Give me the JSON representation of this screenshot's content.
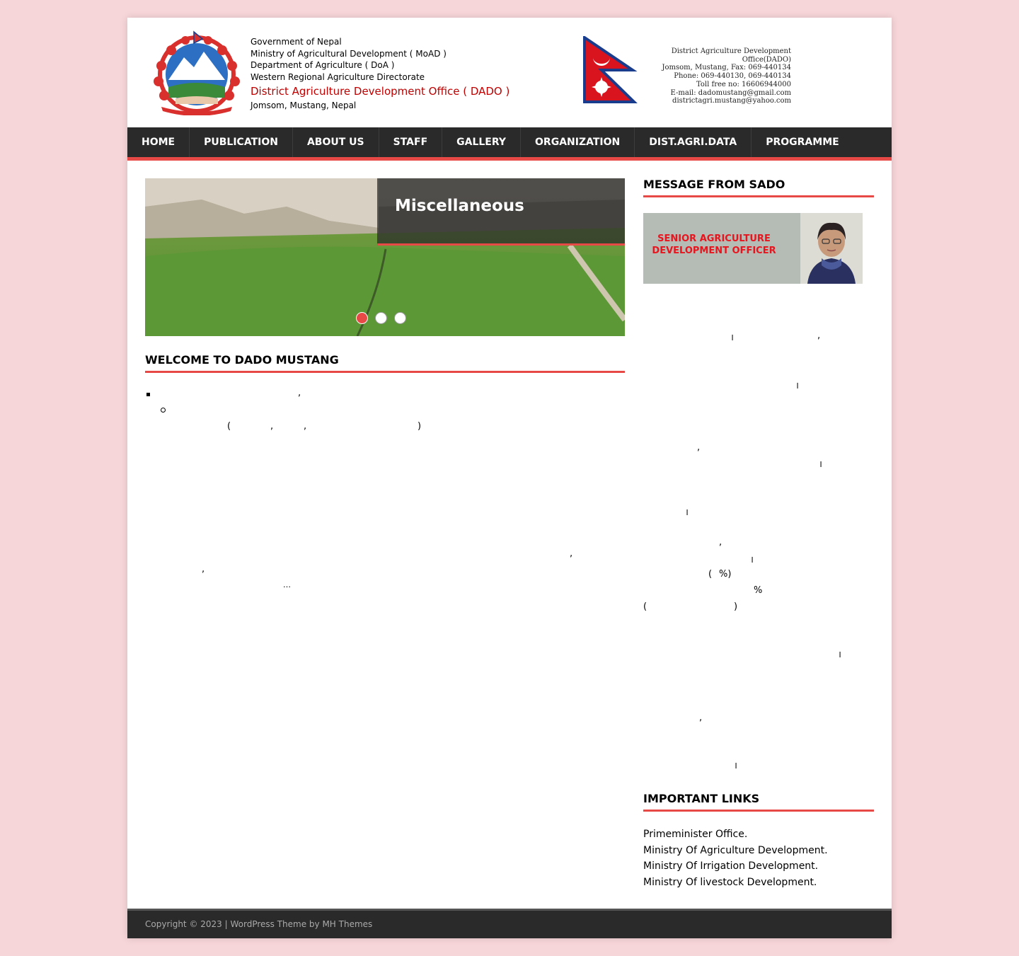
{
  "header": {
    "gov_lines": [
      "Government of Nepal",
      "Ministry of Agricultural Development ( MoAD )",
      "Department of Agriculture ( DoA )",
      "Western Regional Agriculture Directorate"
    ],
    "office_name": "District Agriculture Development Office ( DADO )",
    "location": "Jomsom, Mustang, Nepal",
    "contact_lines": [
      "District Agriculture Development Office(DADO)",
      "Jomsom, Mustang, Fax: 069-440134",
      "Phone: 069-440130, 069-440134",
      "Toll free no: 16606944000",
      "E-mail: dadomustang@gmail.com",
      "districtagri.mustang@yahoo.com"
    ]
  },
  "nav": {
    "items": [
      "HOME",
      "PUBLICATION",
      "ABOUT US",
      "STAFF",
      "GALLERY",
      "ORGANIZATION",
      "DIST.AGRI.DATA",
      "PROGRAMME"
    ]
  },
  "slider": {
    "caption": "Miscellaneous",
    "active_slide": 1,
    "slide_count": 3
  },
  "welcome": {
    "title": "WELCOME TO DADO MUSTANG",
    "glyphs": [
      ",",
      "(",
      ",",
      ",",
      ")",
      ",",
      ",",
      "…"
    ]
  },
  "sidebar": {
    "message_title": "MESSAGE FROM SADO",
    "banner_text": "SENIOR AGRICULTURE DEVELOPMENT OFFICER",
    "glyphs": [
      "।",
      ",",
      "।",
      ",",
      "।",
      "।",
      ",",
      "।",
      "(",
      "%)",
      "%",
      "(",
      ")",
      "।",
      ",",
      "।"
    ],
    "links_title": "IMPORTANT LINKS",
    "links": [
      "Primeminister Office.",
      "Ministry Of Agriculture Development.",
      "Ministry Of Irrigation Development.",
      "Ministry Of livestock Development."
    ]
  },
  "footer": {
    "text": "Copyright © 2023 | WordPress Theme by MH Themes"
  },
  "colors": {
    "page_bg": "#f7d6d9",
    "accent": "#e64946",
    "nav_bg": "#2a2a2a",
    "office_red": "#c00000",
    "banner_red": "#e8141e"
  }
}
